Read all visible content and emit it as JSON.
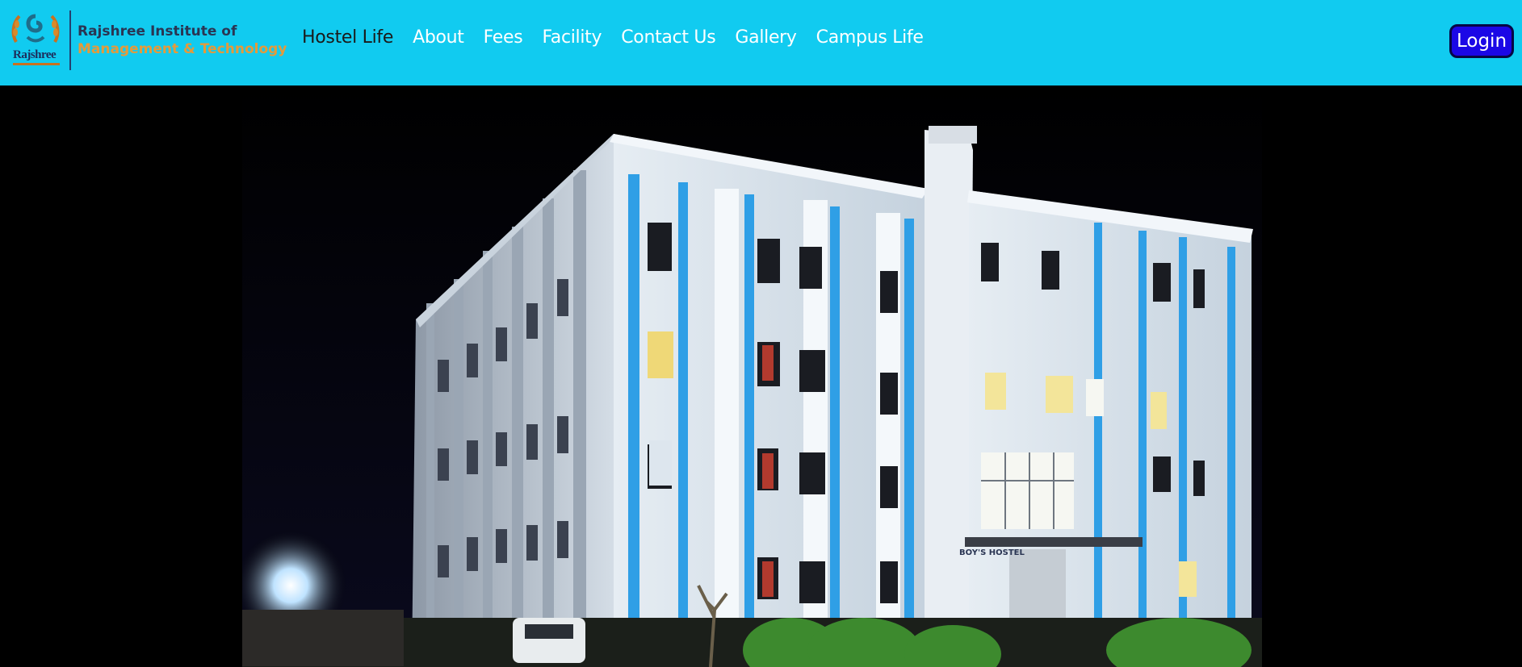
{
  "header": {
    "logo": {
      "wordmark": "Rajshree",
      "name_line1": "Rajshree Institute of",
      "name_line2": "Management & Technology"
    },
    "nav_items": [
      {
        "label": "Hostel Life",
        "active": true
      },
      {
        "label": "About"
      },
      {
        "label": "Fees"
      },
      {
        "label": "Facility"
      },
      {
        "label": "Contact Us"
      },
      {
        "label": "Gallery"
      },
      {
        "label": "Campus Life"
      }
    ],
    "login_label": "Login"
  },
  "hero": {
    "image_sign_text": "BOY'S HOSTEL"
  },
  "colors": {
    "navbar_bg": "#11cbf0",
    "login_bg": "#1b07e6",
    "logo_accent": "#e49a3b",
    "building_accent": "#2f9fe6"
  }
}
